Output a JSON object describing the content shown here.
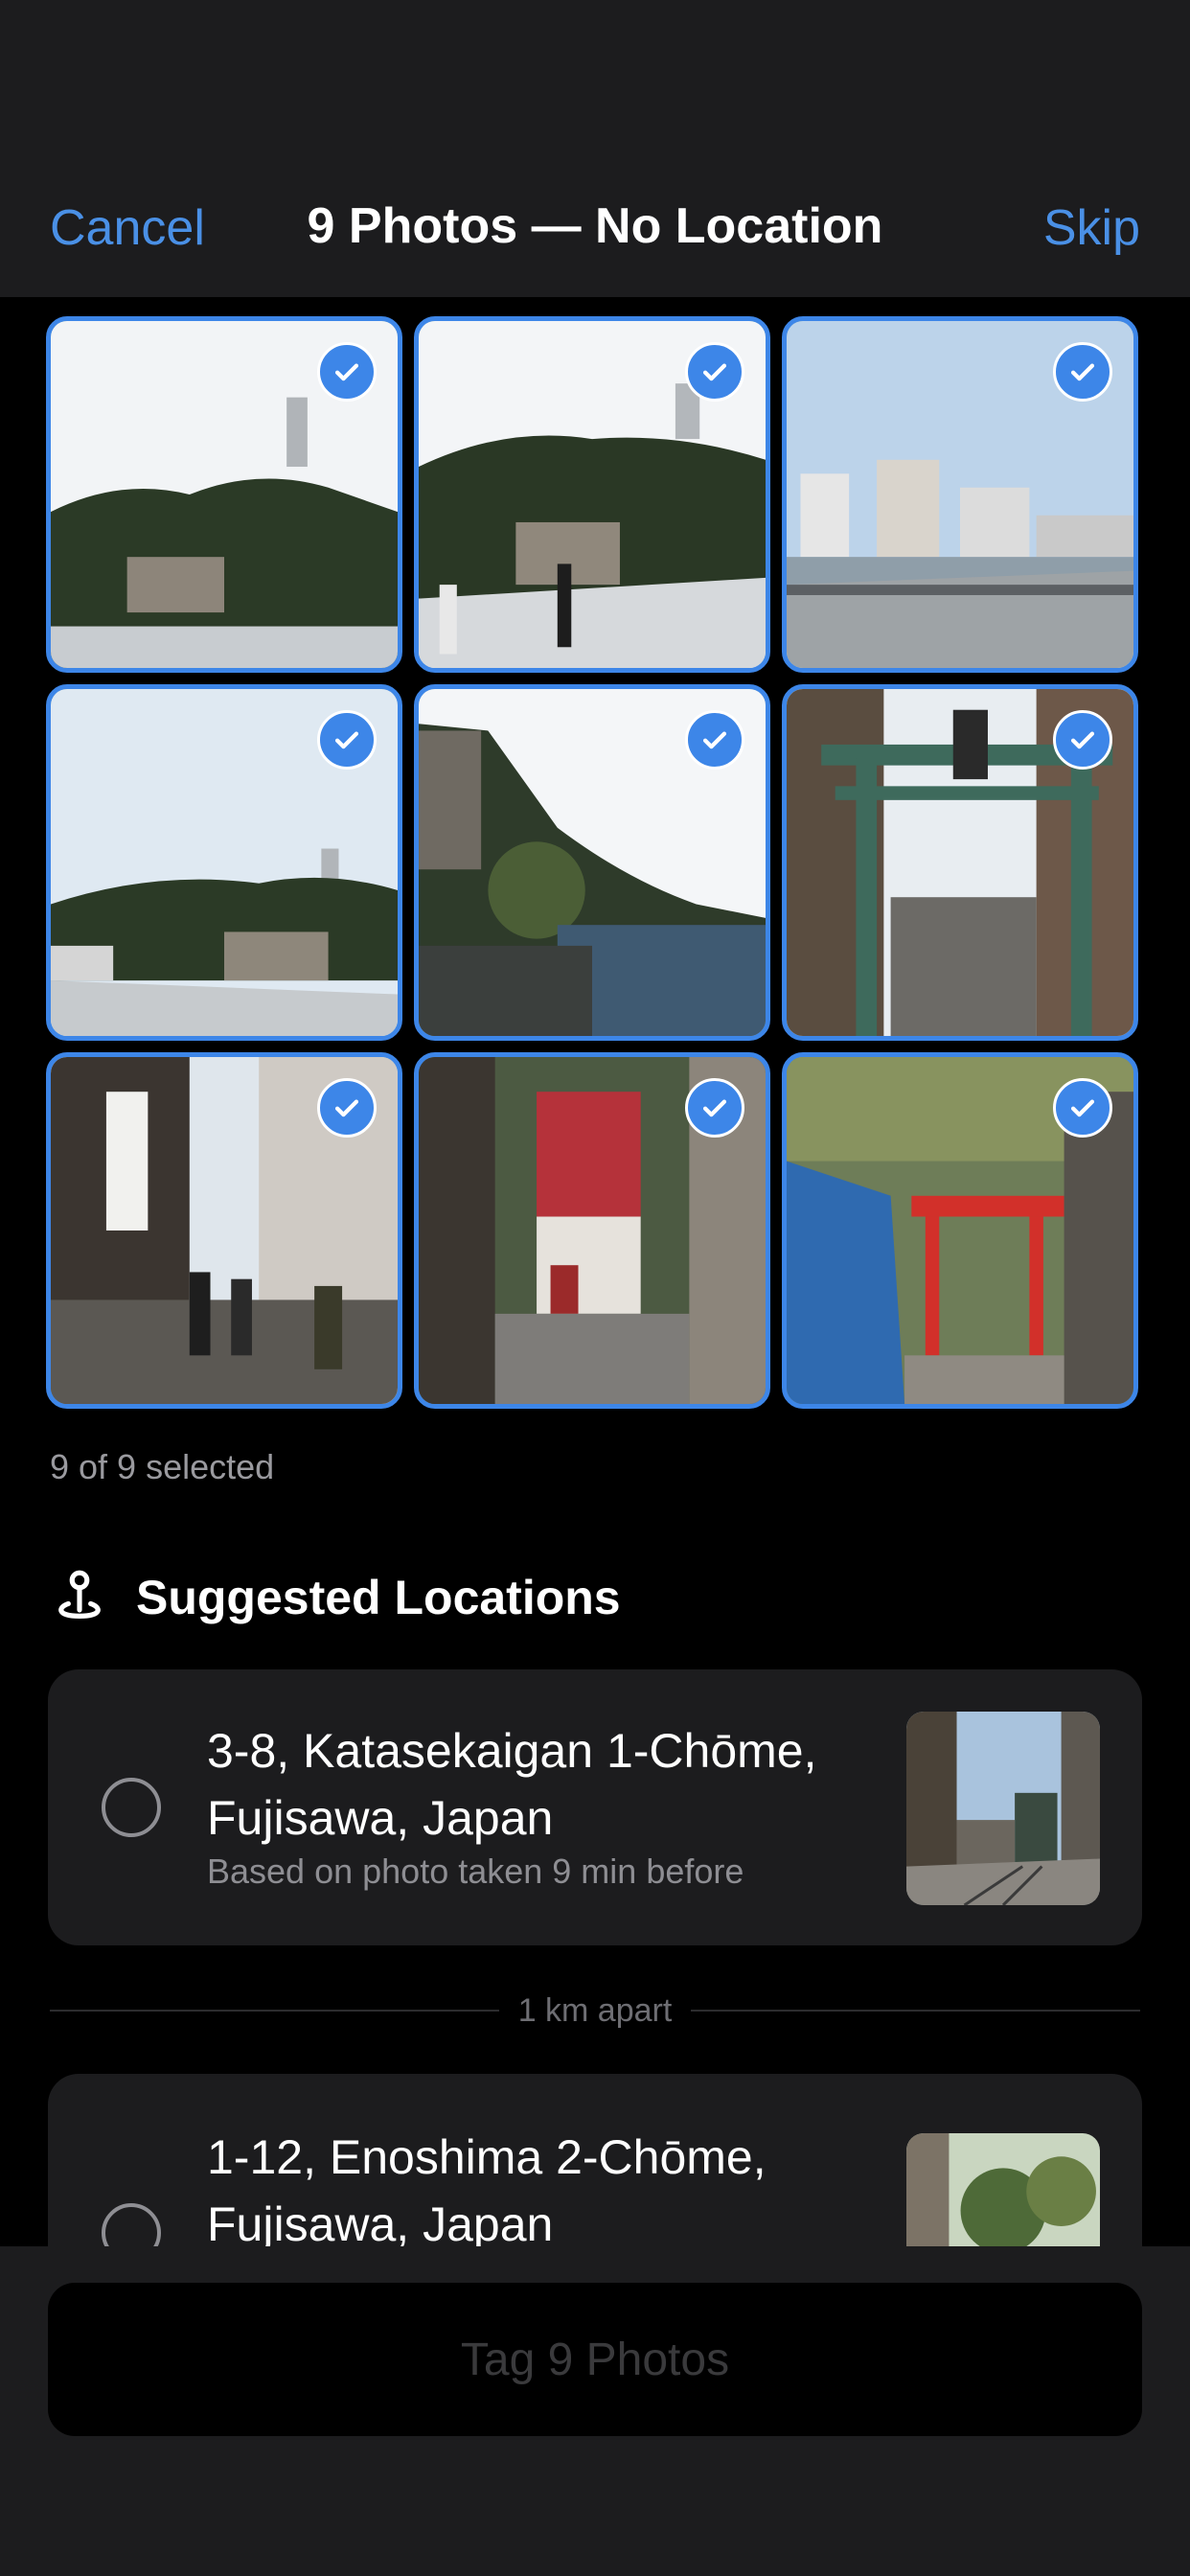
{
  "header": {
    "cancel_label": "Cancel",
    "title": "9 Photos — No Location",
    "skip_label": "Skip"
  },
  "grid": {
    "photos": [
      {
        "subject": "island-tower-bridge",
        "selected": true
      },
      {
        "subject": "island-tower-bridge-people",
        "selected": true
      },
      {
        "subject": "city-buildings-bridge",
        "selected": true
      },
      {
        "subject": "island-tower-wide",
        "selected": true
      },
      {
        "subject": "coast-rocks-sea",
        "selected": true
      },
      {
        "subject": "torii-gate-street",
        "selected": true
      },
      {
        "subject": "shopping-street-crowd",
        "selected": true
      },
      {
        "subject": "red-building-alley",
        "selected": true
      },
      {
        "subject": "red-torii-shrine",
        "selected": true
      }
    ],
    "selected_count_text": "9 of 9 selected"
  },
  "suggested": {
    "title": "Suggested Locations",
    "icon": "location-pin-icon",
    "locations": [
      {
        "address": "3-8, Katasekaigan 1-Chōme, Fujisawa, Japan",
        "basis": "Based on photo taken 9 min before"
      },
      {
        "address": "1-12, Enoshima 2-Chōme, Fujisawa, Japan",
        "basis": ""
      }
    ],
    "separator_text": "1 km apart"
  },
  "bottom": {
    "tag_button_label": "Tag 9 Photos"
  },
  "colors": {
    "accent": "#3d86e8",
    "link": "#4a90e6",
    "background": "#000000",
    "panel": "#1c1c1e",
    "secondary_text": "#8e8e93"
  }
}
